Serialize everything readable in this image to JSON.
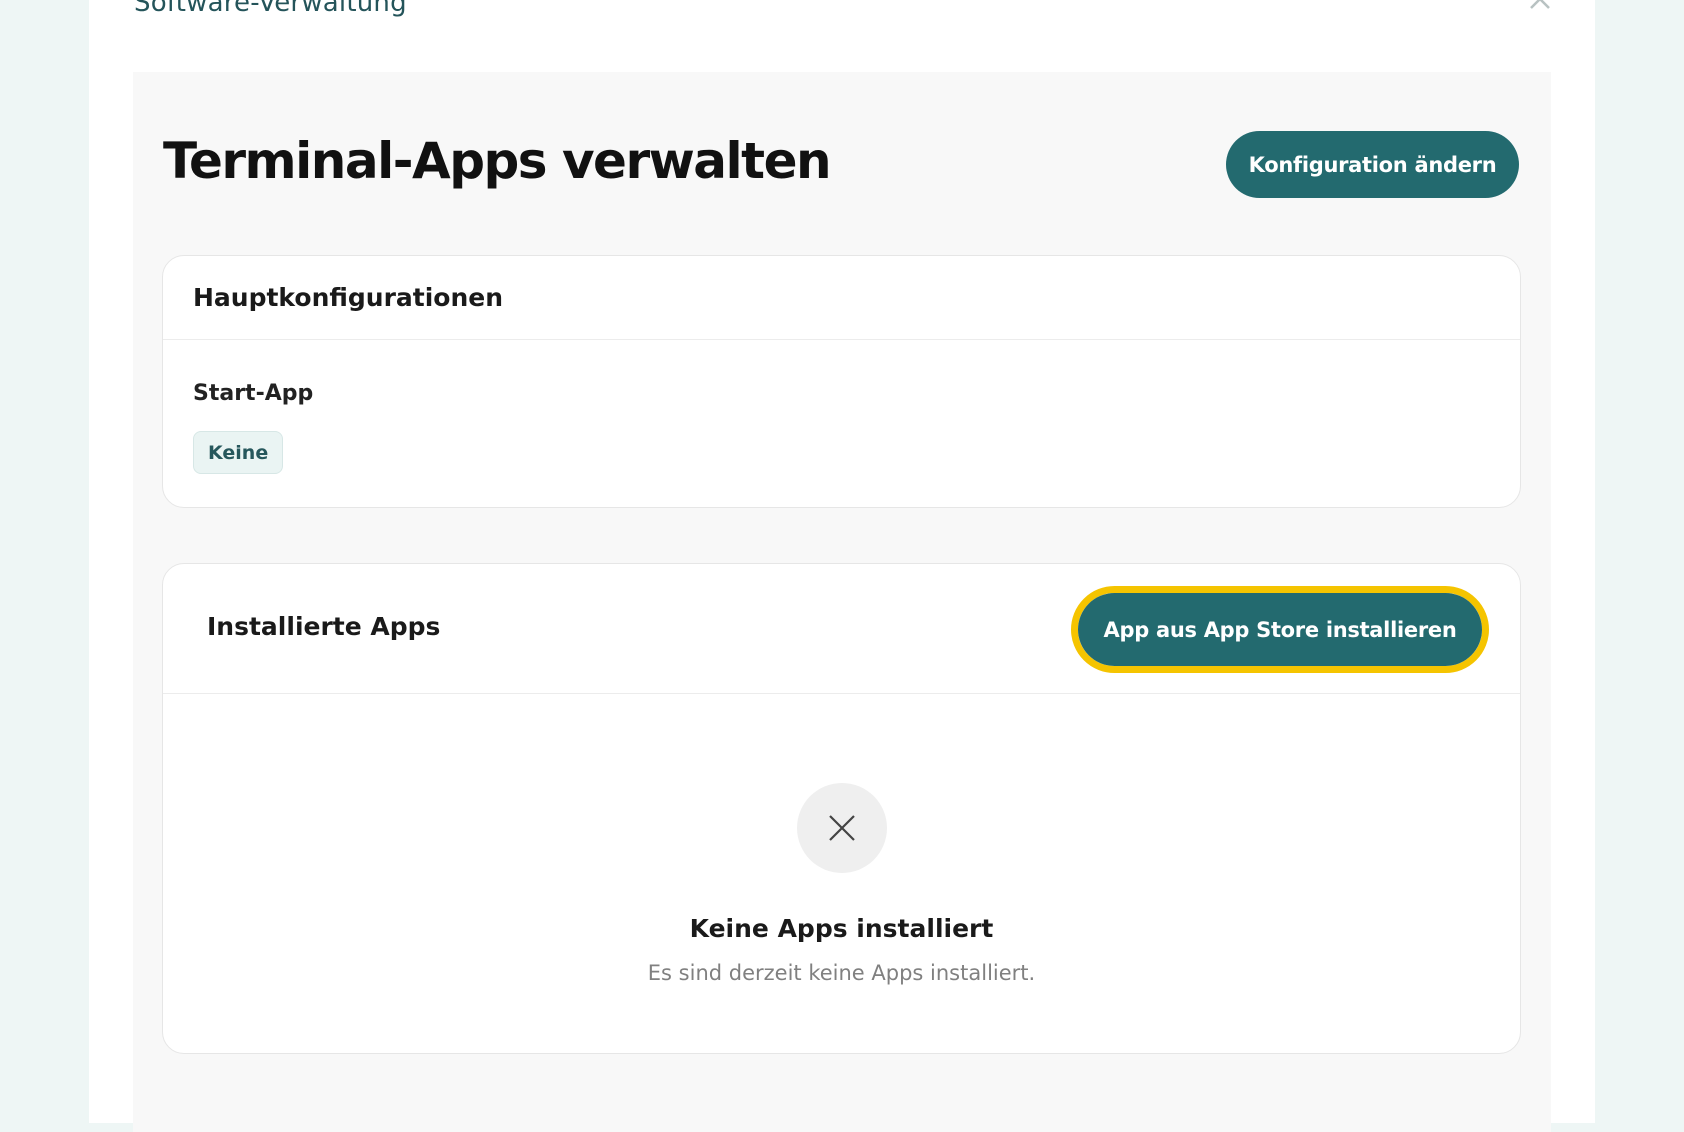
{
  "modal": {
    "title": "Software-Verwaltung",
    "close_icon": "close-icon"
  },
  "page": {
    "title": "Terminal-Apps verwalten",
    "config_button": "Konfiguration ändern"
  },
  "main_config": {
    "title": "Hauptkonfigurationen",
    "start_app_label": "Start-App",
    "start_app_value": "Keine"
  },
  "installed_apps": {
    "title": "Installierte Apps",
    "install_button": "App aus App Store installieren",
    "empty_icon": "x-icon",
    "empty_title": "Keine Apps installiert",
    "empty_subtitle": "Es sind derzeit keine Apps installiert."
  },
  "colors": {
    "primary": "#236a6f",
    "highlight": "#f5c400",
    "background": "#eef6f5"
  }
}
